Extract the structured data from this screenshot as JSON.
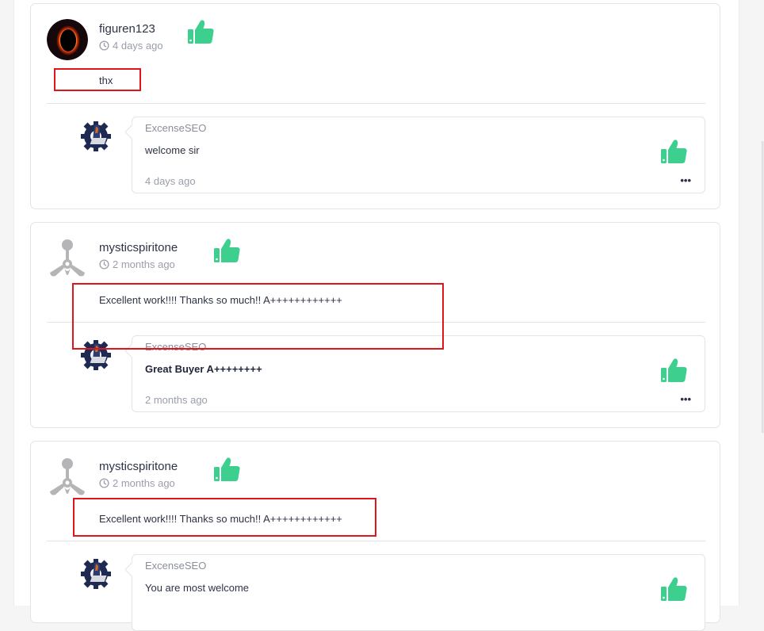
{
  "colors": {
    "accent_green": "#3ccf8e",
    "highlight_red": "#e0141b"
  },
  "comments": [
    {
      "user": "figuren123",
      "time": "4 days ago",
      "text": "thx",
      "reply": {
        "user": "ExcenseSEO",
        "text": "welcome sir",
        "time": "4 days ago",
        "bold": false
      }
    },
    {
      "user": "mysticspiritone",
      "time": "2 months ago",
      "text": "Excellent work!!!! Thanks so much!! A++++++++++++",
      "reply": {
        "user": "ExcenseSEO",
        "text": "Great Buyer A++++++++",
        "time": "2 months ago",
        "bold": true
      }
    },
    {
      "user": "mysticspiritone",
      "time": "2 months ago",
      "text": "Excellent work!!!! Thanks so much!! A++++++++++++",
      "reply": {
        "user": "ExcenseSEO",
        "text": "You are most welcome",
        "time": "",
        "bold": false
      }
    }
  ],
  "icons": {
    "like": "thumbs-up-icon",
    "clock": "clock-icon",
    "more": "more-options-icon"
  },
  "more_glyph": "•••"
}
